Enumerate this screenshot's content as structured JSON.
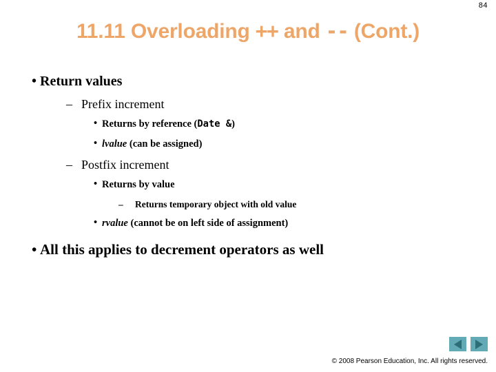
{
  "slide": {
    "page_number": "84",
    "background_color": "#ffffff",
    "title": {
      "prefix": "11.11 Overloading ",
      "op1": "++",
      "middle": " and ",
      "op2": "--",
      "suffix": " (Cont.)",
      "color": "#eda568"
    },
    "outline": [
      {
        "level": 1,
        "marker": "•",
        "text": "Return values"
      },
      {
        "level": 2,
        "marker": "–",
        "text": "Prefix increment"
      },
      {
        "level": 3,
        "marker": "•",
        "text_before": "Returns by reference (",
        "code": "Date &",
        "text_after": ")"
      },
      {
        "level": 3,
        "marker": "•",
        "italic": "lvalue",
        "text_after": " (can be assigned)"
      },
      {
        "level": 2,
        "marker": "–",
        "text": "Postfix increment"
      },
      {
        "level": 3,
        "marker": "•",
        "text": "Returns by value"
      },
      {
        "level": 4,
        "marker": "–",
        "text": "Returns temporary object with old value"
      },
      {
        "level": 3,
        "marker": "•",
        "italic": "rvalue",
        "text_after": " (cannot be on left side of assignment)"
      },
      {
        "level": 1,
        "marker": "•",
        "text": "All this applies to decrement operators as well"
      }
    ],
    "navigation": {
      "previous_label": "◀",
      "next_label": "▶",
      "button_color": "#61aab6",
      "arrow_color": "#2e6e78"
    },
    "copyright": "© 2008 Pearson Education, Inc.  All rights reserved."
  }
}
